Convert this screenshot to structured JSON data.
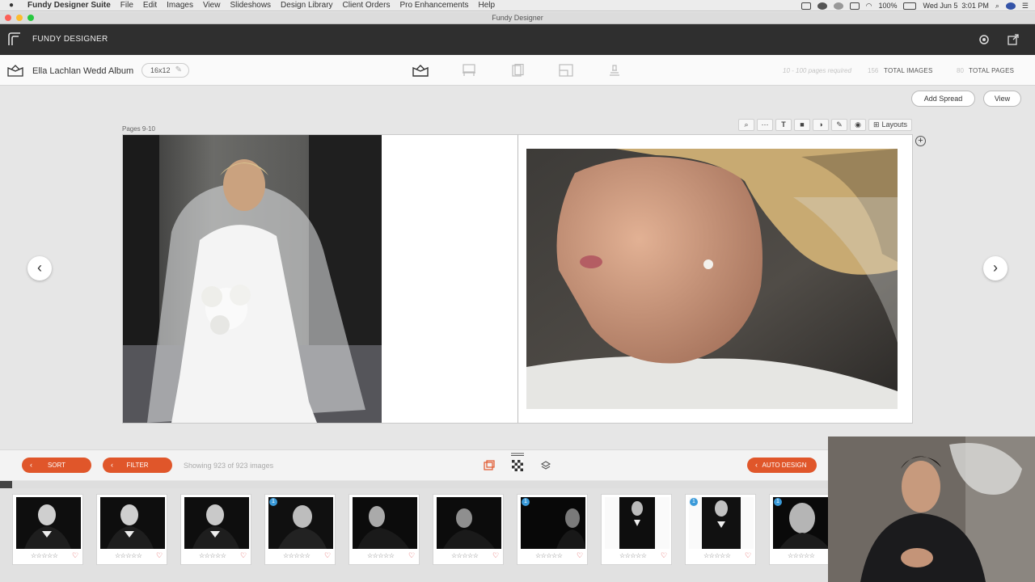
{
  "menubar": {
    "app_name": "Fundy Designer Suite",
    "items": [
      "File",
      "Edit",
      "Images",
      "View",
      "Slideshows",
      "Design Library",
      "Client Orders",
      "Pro Enhancements",
      "Help"
    ],
    "battery": "100%",
    "clock": "Wed Jun 5  3:01 PM"
  },
  "window": {
    "title": "Fundy Designer"
  },
  "header": {
    "app_label": "FUNDY DESIGNER"
  },
  "album": {
    "name": "Ella Lachlan Wedd Album",
    "size": "16x12",
    "pages_required_note": "10 - 100 pages required",
    "total_images_count": "156",
    "total_images_label": "TOTAL IMAGES",
    "total_pages_count": "80",
    "total_pages_label": "TOTAL PAGES",
    "modes": [
      "album-mode-icon",
      "wall-art-icon",
      "card-icon",
      "layout-icon",
      "stack-icon"
    ]
  },
  "workspace": {
    "add_spread_label": "Add Spread",
    "view_label": "View",
    "pages_label": "Pages 9-10",
    "layouts_label": "Layouts",
    "tools": [
      "zoom-icon",
      "line-icon",
      "text-icon",
      "shape-icon",
      "color-icon",
      "pin-icon",
      "eye-icon"
    ],
    "prev_glyph": "‹",
    "next_glyph": "›",
    "add_page_glyph": "+"
  },
  "browser": {
    "sort_label": "SORT",
    "filter_label": "FILTER",
    "showing_text": "Showing 923 of 923 images",
    "auto_design_label": "AUTO DESIGN",
    "progress": 0.012,
    "thumbnails": [
      {
        "badge": "",
        "stars": "☆☆☆☆☆",
        "heart": "♡"
      },
      {
        "badge": "",
        "stars": "☆☆☆☆☆",
        "heart": "♡"
      },
      {
        "badge": "",
        "stars": "☆☆☆☆☆",
        "heart": "♡"
      },
      {
        "badge": "1",
        "stars": "☆☆☆☆☆",
        "heart": "♡"
      },
      {
        "badge": "",
        "stars": "☆☆☆☆☆",
        "heart": "♡"
      },
      {
        "badge": "",
        "stars": "☆☆☆☆☆",
        "heart": "♡"
      },
      {
        "badge": "1",
        "stars": "☆☆☆☆☆",
        "heart": "♡"
      },
      {
        "badge": "",
        "stars": "☆☆☆☆☆",
        "heart": "♡"
      },
      {
        "badge": "1",
        "stars": "☆☆☆☆☆",
        "heart": "♡"
      },
      {
        "badge": "1",
        "stars": "☆☆☆☆☆",
        "heart": "♡"
      }
    ]
  },
  "colors": {
    "accent": "#e0562a",
    "header_bg": "#2f2f2f",
    "badge": "#3a9ad9"
  }
}
